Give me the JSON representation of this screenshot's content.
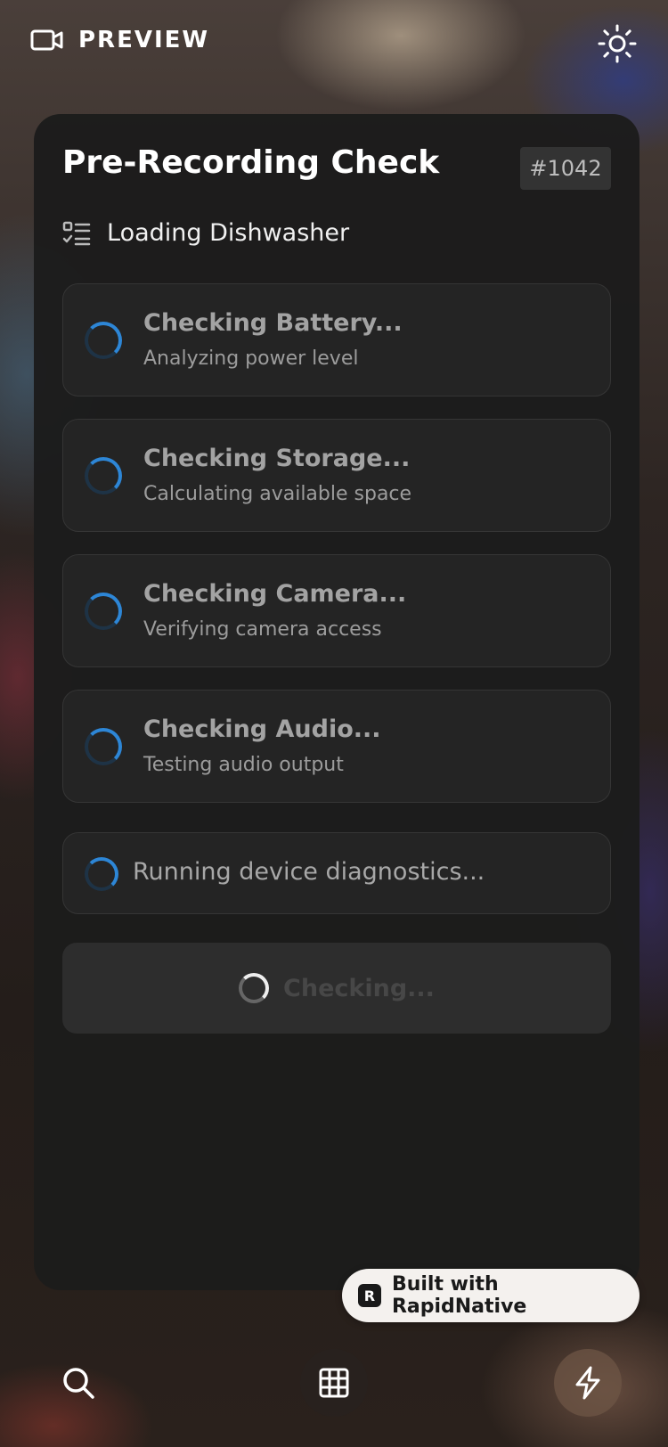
{
  "header": {
    "preview_label": "PREVIEW",
    "preview_icon": "video-camera-icon",
    "theme_icon": "sun-icon"
  },
  "card": {
    "title": "Pre-Recording Check",
    "id_badge": "#1042",
    "task_icon": "checklist-icon",
    "task_name": "Loading Dishwasher",
    "checks": [
      {
        "title": "Checking Battery...",
        "subtitle": "Analyzing power level"
      },
      {
        "title": "Checking Storage...",
        "subtitle": "Calculating available space"
      },
      {
        "title": "Checking Camera...",
        "subtitle": "Verifying camera access"
      },
      {
        "title": "Checking Audio...",
        "subtitle": "Testing audio output"
      }
    ],
    "diagnostics_text": "Running device diagnostics...",
    "button_label": "Checking..."
  },
  "footer": {
    "built_with": "Built with RapidNative",
    "logo_letter": "R",
    "icons": [
      "search-icon",
      "grid-icon",
      "lightning-icon"
    ]
  },
  "colors": {
    "accent_blue": "#2d86d6",
    "card_bg": "#1c1c1c",
    "item_bg": "#242424"
  }
}
